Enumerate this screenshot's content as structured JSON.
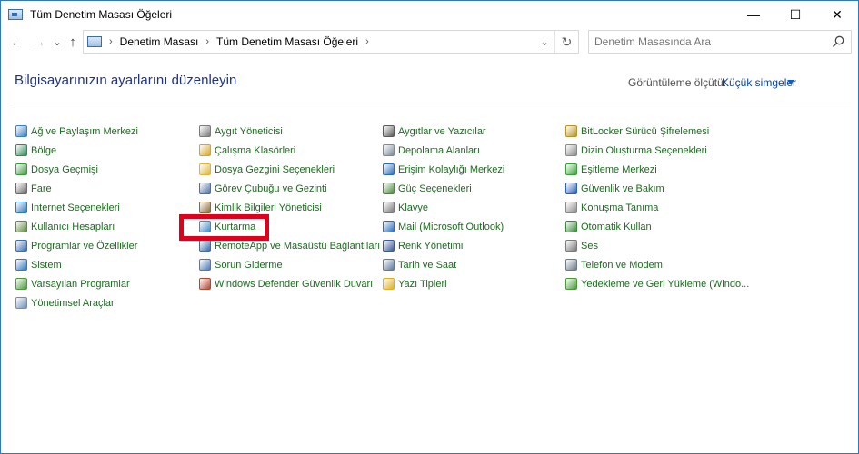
{
  "window": {
    "title": "Tüm Denetim Masası Öğeleri",
    "controls": {
      "minimize": "—",
      "maximize": "☐",
      "close": "✕"
    }
  },
  "nav": {
    "back": "←",
    "forward": "→",
    "recent": "⌄",
    "up": "↑",
    "breadcrumb": [
      "Denetim Masası",
      "Tüm Denetim Masası Öğeleri"
    ],
    "separator": "›",
    "dropdown": "⌄",
    "refresh": "↻"
  },
  "search": {
    "placeholder": "Denetim Masasında Ara"
  },
  "header": {
    "title": "Bilgisayarınızın ayarlarını düzenleyin",
    "view_by_label": "Görüntüleme ölçütü:",
    "view_by_value": "Küçük simgeler"
  },
  "columns": [
    [
      {
        "label": "Ağ ve Paylaşım Merkezi",
        "icon": "network-icon",
        "color": "#3b7fc4"
      },
      {
        "label": "Bölge",
        "icon": "globe-clock-icon",
        "color": "#2e8b57"
      },
      {
        "label": "Dosya Geçmişi",
        "icon": "file-history-icon",
        "color": "#3c9a3c"
      },
      {
        "label": "Fare",
        "icon": "mouse-icon",
        "color": "#6a6a6a"
      },
      {
        "label": "Internet Seçenekleri",
        "icon": "internet-options-icon",
        "color": "#2b79c2"
      },
      {
        "label": "Kullanıcı Hesapları",
        "icon": "user-accounts-icon",
        "color": "#5d8a3c"
      },
      {
        "label": "Programlar ve Özellikler",
        "icon": "programs-icon",
        "color": "#3b6db3"
      },
      {
        "label": "Sistem",
        "icon": "system-icon",
        "color": "#2f78c4"
      },
      {
        "label": "Varsayılan Programlar",
        "icon": "default-programs-icon",
        "color": "#4a9a3a"
      },
      {
        "label": "Yönetimsel Araçlar",
        "icon": "admin-tools-icon",
        "color": "#6b8fb8"
      }
    ],
    [
      {
        "label": "Aygıt Yöneticisi",
        "icon": "device-manager-icon",
        "color": "#7a7a7a"
      },
      {
        "label": "Çalışma Klasörleri",
        "icon": "work-folders-icon",
        "color": "#d9a520"
      },
      {
        "label": "Dosya Gezgini Seçenekleri",
        "icon": "folder-options-icon",
        "color": "#e0b43a"
      },
      {
        "label": "Görev Çubuğu ve Gezinti",
        "icon": "taskbar-icon",
        "color": "#4a6fa5"
      },
      {
        "label": "Kimlik Bilgileri Yöneticisi",
        "icon": "credential-manager-icon",
        "color": "#8a6a3a"
      },
      {
        "label": "Kurtarma",
        "icon": "recovery-icon",
        "color": "#3c8ac8"
      },
      {
        "label": "RemoteApp ve Masaüstü Bağlantıları",
        "icon": "remoteapp-icon",
        "color": "#3a6ab0"
      },
      {
        "label": "Sorun Giderme",
        "icon": "troubleshooting-icon",
        "color": "#4a7ab8"
      },
      {
        "label": "Windows Defender Güvenlik Duvarı",
        "icon": "firewall-icon",
        "color": "#b5472e"
      }
    ],
    [
      {
        "label": "Aygıtlar ve Yazıcılar",
        "icon": "devices-printers-icon",
        "color": "#5a5a5a"
      },
      {
        "label": "Depolama Alanları",
        "icon": "storage-spaces-icon",
        "color": "#7a8a9a"
      },
      {
        "label": "Erişim Kolaylığı Merkezi",
        "icon": "ease-of-access-icon",
        "color": "#2c6cc0"
      },
      {
        "label": "Güç Seçenekleri",
        "icon": "power-options-icon",
        "color": "#4a8a3a"
      },
      {
        "label": "Klavye",
        "icon": "keyboard-icon",
        "color": "#7a7a7a"
      },
      {
        "label": "Mail (Microsoft Outlook)",
        "icon": "mail-icon",
        "color": "#2a6fc0"
      },
      {
        "label": "Renk Yönetimi",
        "icon": "color-management-icon",
        "color": "#3a5a9a"
      },
      {
        "label": "Tarih ve Saat",
        "icon": "date-time-icon",
        "color": "#5a7aa0"
      },
      {
        "label": "Yazı Tipleri",
        "icon": "fonts-icon",
        "color": "#e0b020"
      }
    ],
    [
      {
        "label": "BitLocker Sürücü Şifrelemesi",
        "icon": "bitlocker-icon",
        "color": "#b8932a"
      },
      {
        "label": "Dizin Oluşturma Seçenekleri",
        "icon": "indexing-icon",
        "color": "#8a8a8a"
      },
      {
        "label": "Eşitleme Merkezi",
        "icon": "sync-center-icon",
        "color": "#3aa03a"
      },
      {
        "label": "Güvenlik ve Bakım",
        "icon": "security-flag-icon",
        "color": "#2a5fb8"
      },
      {
        "label": "Konuşma Tanıma",
        "icon": "speech-icon",
        "color": "#8a8a8a"
      },
      {
        "label": "Otomatik Kullan",
        "icon": "autoplay-icon",
        "color": "#3a8a3a"
      },
      {
        "label": "Ses",
        "icon": "sound-icon",
        "color": "#7a7a7a"
      },
      {
        "label": "Telefon ve Modem",
        "icon": "phone-modem-icon",
        "color": "#6a7a8a"
      },
      {
        "label": "Yedekleme ve Geri Yükleme (Windo...",
        "icon": "backup-restore-icon",
        "color": "#4a9a3a"
      }
    ]
  ]
}
